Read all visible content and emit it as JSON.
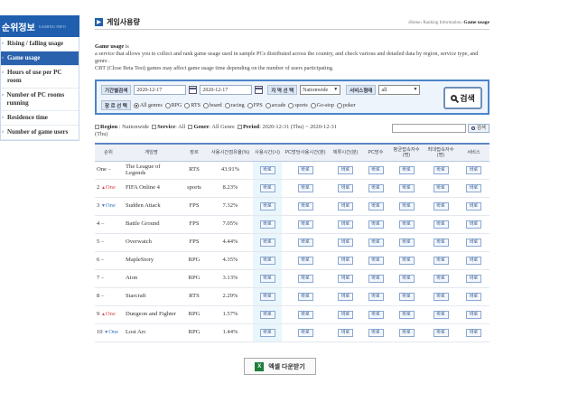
{
  "sidebar": {
    "title": "순위정보",
    "subtitle": "GAMING INFO",
    "items": [
      {
        "label": "Rising / falling usage",
        "active": false
      },
      {
        "label": "Game usage",
        "active": true
      },
      {
        "label": "Hours of use per PC room",
        "active": false
      },
      {
        "label": "Number of PC rooms running",
        "active": false
      },
      {
        "label": "Residence time",
        "active": false
      },
      {
        "label": "Number of game users",
        "active": false
      }
    ]
  },
  "page": {
    "title_icon": "▶",
    "title": "게임사용량",
    "breadcrumb_prefix": "›Home› Ranking Information›",
    "breadcrumb_current": "Game usage"
  },
  "description": {
    "heading": "Game usage",
    "heading_suffix": "is",
    "line1": "a service that allows you to collect and rank game usage used in sample PCs distributed across the country, and check various and detailed data by region, service type, and genre .",
    "line2": "CBT (Close Beta Test) games may affect game usage time depending on the number of users participating."
  },
  "search_panel": {
    "period_label": "기간별검색",
    "date_from": "2020-12-17",
    "date_to": "2020-12-17",
    "region_label": "지 역 선 택",
    "region_value": "Nationwide",
    "service_label": "서비스형태",
    "service_value": "all",
    "genre_label": "장 르 선 택",
    "genres": [
      {
        "label": "All genres",
        "checked": true
      },
      {
        "label": "RPG",
        "checked": false
      },
      {
        "label": "RTS",
        "checked": false
      },
      {
        "label": "board",
        "checked": false
      },
      {
        "label": "racing",
        "checked": false
      },
      {
        "label": "FPS",
        "checked": false
      },
      {
        "label": "arcade",
        "checked": false
      },
      {
        "label": "sports",
        "checked": false
      },
      {
        "label": "Go-stop",
        "checked": false
      },
      {
        "label": "poker",
        "checked": false
      }
    ],
    "search_button": "검색"
  },
  "filter_summary": {
    "region_key": "Region",
    "region_val": ": Nationwide",
    "service_key": "Service",
    "service_val": ": All",
    "genre_key": "Genre",
    "genre_val": ": All Genre",
    "period_key": "Period",
    "period_val": ": 2020-12-31 (Thu) ~ 2020-12-31",
    "period_val2": "(Thu)",
    "mini_search_button": "검색"
  },
  "table": {
    "headers": [
      "순위",
      "게임명",
      "장르",
      "사용시간점유율(%)",
      "사용시간(시)",
      "PC방당사용시간(분)",
      "체류시간(분)",
      "PC방수",
      "평균접속자수(명)",
      "최대접속자수(명)",
      "서비스"
    ],
    "view_label": "바로",
    "rows": [
      {
        "rank": "One",
        "dir": "same",
        "change": "",
        "game": "The League of Legends",
        "genre": "RTS",
        "share": "43.91%"
      },
      {
        "rank": "2",
        "dir": "up",
        "change": "One",
        "game": "FIFA Online 4",
        "genre": "sports",
        "share": "8.23%"
      },
      {
        "rank": "3",
        "dir": "down",
        "change": "One",
        "game": "Sudden Attack",
        "genre": "FPS",
        "share": "7.32%"
      },
      {
        "rank": "4",
        "dir": "same",
        "change": "",
        "game": "Battle Ground",
        "genre": "FPS",
        "share": "7.05%"
      },
      {
        "rank": "5",
        "dir": "same",
        "change": "",
        "game": "Overwatch",
        "genre": "FPS",
        "share": "4.44%"
      },
      {
        "rank": "6",
        "dir": "same",
        "change": "",
        "game": "MapleStory",
        "genre": "RPG",
        "share": "4.35%"
      },
      {
        "rank": "7",
        "dir": "same",
        "change": "",
        "game": "Aion",
        "genre": "RPG",
        "share": "3.13%"
      },
      {
        "rank": "8",
        "dir": "same",
        "change": "",
        "game": "Starcraft",
        "genre": "RTS",
        "share": "2.29%"
      },
      {
        "rank": "9",
        "dir": "up",
        "change": "One",
        "game": "Dungeon and Fighter",
        "genre": "RPG",
        "share": "1.57%"
      },
      {
        "rank": "10",
        "dir": "down",
        "change": "One",
        "game": "Lost Arc",
        "genre": "RPG",
        "share": "1.44%"
      }
    ]
  },
  "excel_button": {
    "icon": "X",
    "label": "엑셀 다운받기"
  }
}
